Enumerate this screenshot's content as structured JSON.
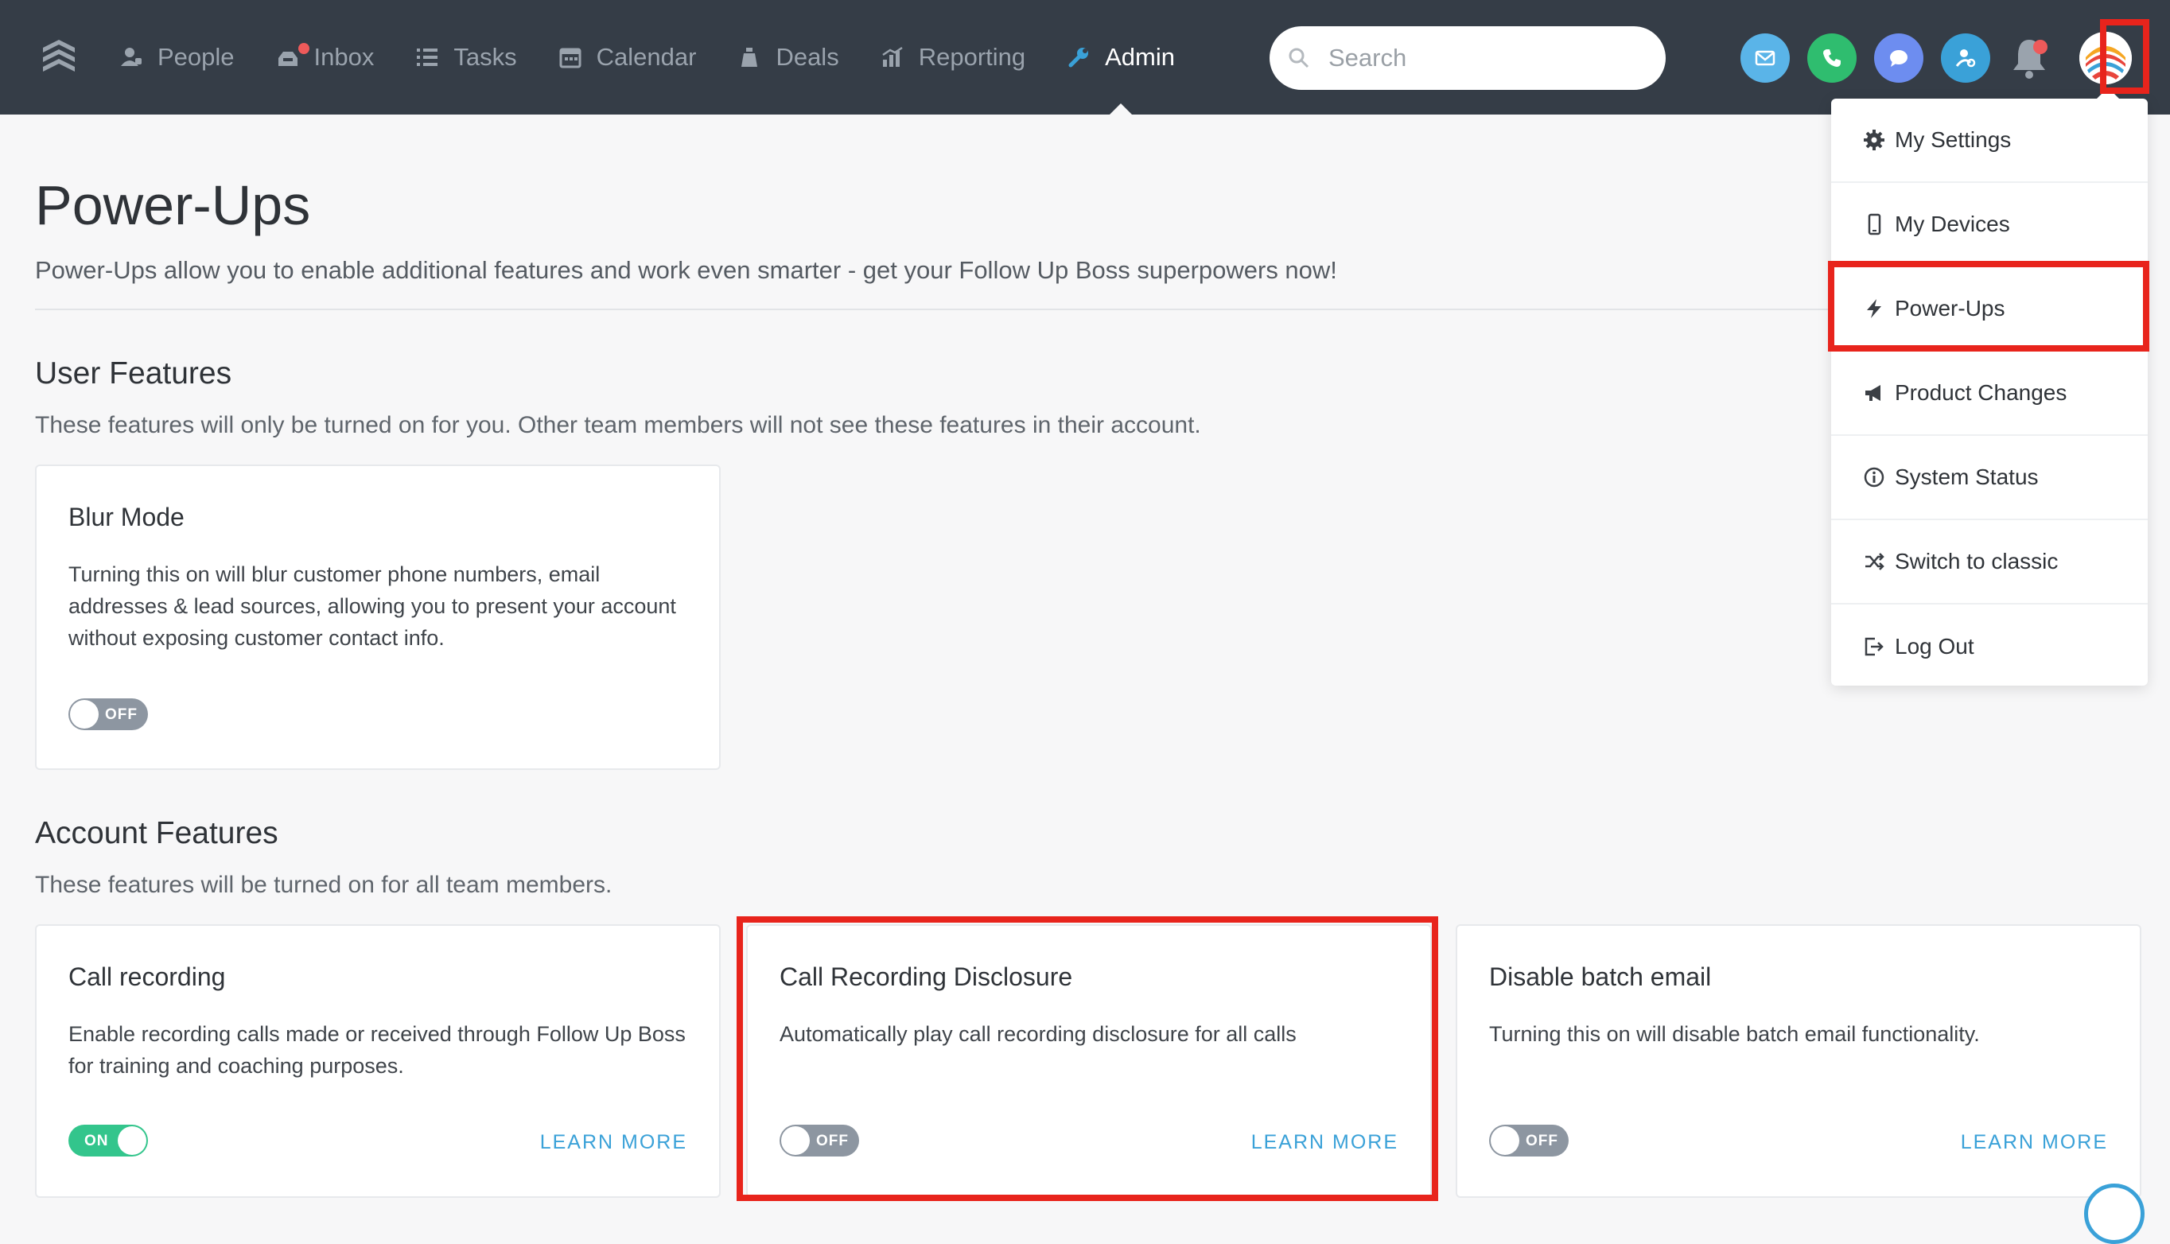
{
  "nav": {
    "items": [
      {
        "label": "People",
        "icon": "person-icon"
      },
      {
        "label": "Inbox",
        "icon": "inbox-icon"
      },
      {
        "label": "Tasks",
        "icon": "tasks-icon"
      },
      {
        "label": "Calendar",
        "icon": "calendar-icon"
      },
      {
        "label": "Deals",
        "icon": "money-bag-icon"
      },
      {
        "label": "Reporting",
        "icon": "chart-icon"
      },
      {
        "label": "Admin",
        "icon": "wrench-icon",
        "active": true
      }
    ],
    "search_placeholder": "Search"
  },
  "colors": {
    "topbar": "#353d47",
    "email": "#5ab4e8",
    "phone": "#2fbd6f",
    "chat": "#6d8df0",
    "dialer": "#3aa1d8",
    "toggle_on": "#33c58c",
    "toggle_off": "#8d96a1",
    "link": "#3aa1d8",
    "highlight": "#e8241c"
  },
  "page": {
    "title": "Power-Ups",
    "subtitle": "Power-Ups allow you to enable additional features and work even smarter - get your Follow Up Boss superpowers now!"
  },
  "user_features": {
    "title": "User Features",
    "description": "These features will only be turned on for you. Other team members will not see these features in their account.",
    "cards": [
      {
        "title": "Blur Mode",
        "text": "Turning this on will blur customer phone numbers, email addresses & lead sources, allowing you to present your account without exposing customer contact info.",
        "toggle": "OFF"
      }
    ]
  },
  "account_features": {
    "title": "Account Features",
    "description": "These features will be turned on for all team members.",
    "cards": [
      {
        "title": "Call recording",
        "text": "Enable recording calls made or received through Follow Up Boss for training and coaching purposes.",
        "toggle": "ON",
        "link": "LEARN MORE"
      },
      {
        "title": "Call Recording Disclosure",
        "text": "Automatically play call recording disclosure for all calls",
        "toggle": "OFF",
        "link": "LEARN MORE"
      },
      {
        "title": "Disable batch email",
        "text": "Turning this on will disable batch email functionality.",
        "toggle": "OFF",
        "link": "LEARN MORE"
      }
    ]
  },
  "dropdown": {
    "items": [
      {
        "label": "My Settings",
        "icon": "gear-icon"
      },
      {
        "label": "My Devices",
        "icon": "phone-device-icon"
      },
      {
        "label": "Power-Ups",
        "icon": "lightning-icon"
      },
      {
        "label": "Product Changes",
        "icon": "megaphone-icon"
      },
      {
        "label": "System Status",
        "icon": "info-icon"
      },
      {
        "label": "Switch to classic",
        "icon": "shuffle-icon"
      },
      {
        "label": "Log Out",
        "icon": "logout-icon"
      }
    ]
  }
}
